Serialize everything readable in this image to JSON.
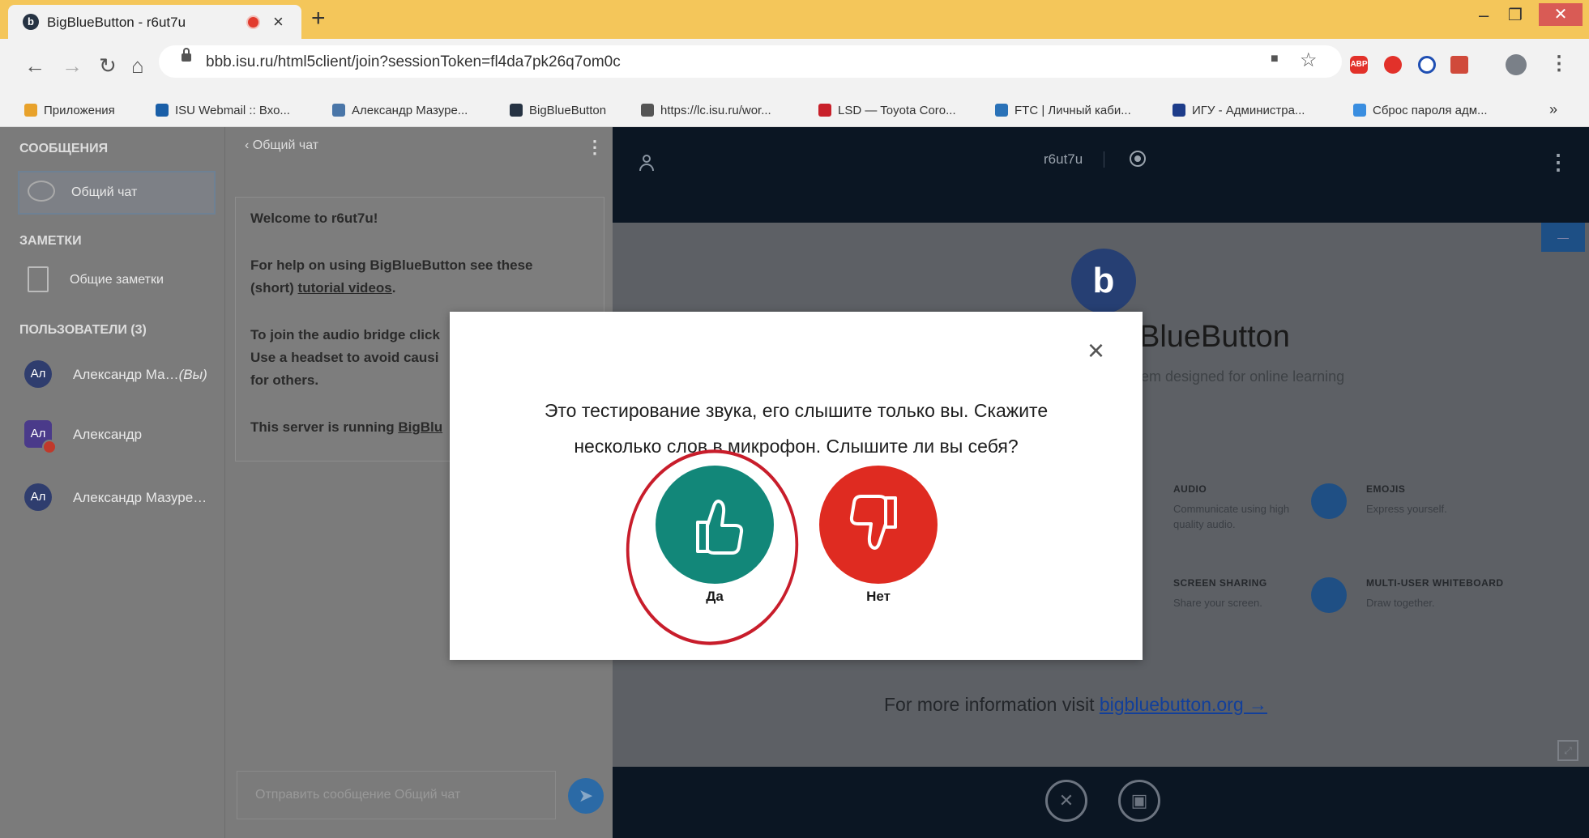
{
  "browser": {
    "tab_title": "BigBlueButton - r6ut7u",
    "tab_close": "×",
    "new_tab": "+",
    "favicon_letter": "b",
    "window": {
      "minimize": "–",
      "maximize": "❐",
      "close": "✕"
    },
    "url": "bbb.isu.ru/html5client/join?sessionToken=fl4da7pk26q7om0c",
    "nav": {
      "back": "←",
      "forward": "→",
      "reload": "↻",
      "home": "⌂"
    },
    "toolbar_icons": {
      "camera": "■",
      "star": "☆",
      "abp": "ABP",
      "menu": "⋮"
    },
    "bookmarks": [
      {
        "label": "Приложения",
        "icon_color": "#e8a22b",
        "icon": "apps-icon"
      },
      {
        "label": "ISU Webmail :: Вхо...",
        "icon_color": "#1a5fa8",
        "icon": "webmail-icon"
      },
      {
        "label": "Александр Мазуре...",
        "icon_color": "#4a76a8",
        "icon": "vk-icon"
      },
      {
        "label": "BigBlueButton",
        "icon_color": "#263343",
        "icon": "bbb-icon"
      },
      {
        "label": "https://lc.isu.ru/wor...",
        "icon_color": "#555555",
        "icon": "globe-icon"
      },
      {
        "label": "LSD — Toyota Coro...",
        "icon_color": "#c8202a",
        "icon": "lsd-icon"
      },
      {
        "label": "FTC | Личный каби...",
        "icon_color": "#2a72b8",
        "icon": "ftc-icon"
      },
      {
        "label": "ИГУ - Администра...",
        "icon_color": "#1d3c8a",
        "icon": "isu-icon"
      },
      {
        "label": "Сброс пароля адм...",
        "icon_color": "#3a8ee0",
        "icon": "reset-icon"
      }
    ],
    "bookmarks_more": "»"
  },
  "sidebar": {
    "messages_header": "СООБЩЕНИЯ",
    "public_chat": "Общий чат",
    "notes_header": "ЗАМЕТКИ",
    "shared_notes": "Общие заметки",
    "users_header": "ПОЛЬЗОВАТЕЛИ (3)",
    "users": [
      {
        "initials": "Ал",
        "name": "Александр Ма…",
        "suffix": "(Вы)"
      },
      {
        "initials": "Ал",
        "name": "Александр",
        "suffix": ""
      },
      {
        "initials": "Ал",
        "name": "Александр Мазуре…",
        "suffix": ""
      }
    ]
  },
  "chat": {
    "back_label": "‹  Общий чат",
    "kebab": "⋮",
    "welcome_title": "Welcome to r6ut7u!",
    "help_line1": "For help on using BigBlueButton see these",
    "help_line2_pre": "(short) ",
    "help_link": "tutorial videos",
    "help_line2_post": ".",
    "audio_line1": "To join the audio bridge click",
    "audio_line2": "Use a headset to avoid causi",
    "audio_line3": "for others.",
    "server_pre": "This server is running ",
    "server_link": "BigBlu",
    "input_placeholder": "Отправить сообщение Общий чат",
    "send": "➤"
  },
  "presentation": {
    "room_name": "r6ut7u",
    "kebab": "⋮",
    "minimize": "—",
    "logo_letter": "b",
    "title": "BlueButton",
    "tagline": "system designed for online learning",
    "features": [
      {
        "title": "AUDIO",
        "desc": "Communicate using high quality audio."
      },
      {
        "title": "EMOJIS",
        "desc": "Express yourself."
      },
      {
        "title": "SCREEN SHARING",
        "desc": "Share your screen."
      },
      {
        "title": "MULTI-USER WHITEBOARD",
        "desc": "Draw together."
      }
    ],
    "more_info_pre": "For more information visit ",
    "more_info_link": "bigbluebutton.org →",
    "controls": {
      "audio": "✕",
      "video": "▣"
    },
    "fullscreen": "⤢"
  },
  "modal": {
    "close": "×",
    "question_line1": "Это тестирование звука, его слышите только вы. Скажите",
    "question_line2": "несколько слов в микрофон. Слышите ли вы себя?",
    "yes_label": "Да",
    "no_label": "Нет"
  },
  "colors": {
    "yes": "#128779",
    "no": "#df2b21",
    "annotation_circle": "#c81d2b",
    "top_bar": "#0b1623"
  }
}
